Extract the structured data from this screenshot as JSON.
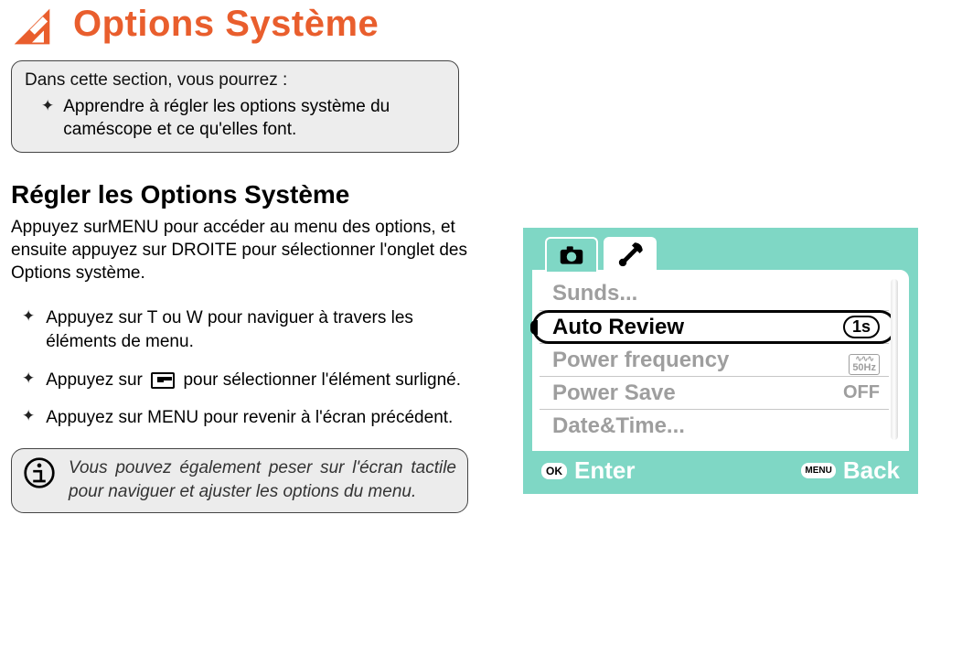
{
  "header": {
    "title": "Options Système"
  },
  "intro": {
    "lead": "Dans cette section, vous pourrez :",
    "item": "Apprendre à régler les options système du caméscope et ce qu'elles font."
  },
  "section": {
    "title": "Régler les Options Système",
    "paragraph": "Appuyez surMENU pour accéder au menu des options, et ensuite appuyez sur DROITE pour sélectionner l'onglet des Options système.",
    "bullets": {
      "b1": "Appuyez sur T ou W pour naviguer à travers les éléments de menu.",
      "b2a": "Appuyez sur",
      "b2b": "pour sélectionner l'élément surligné.",
      "b3": "Appuyez sur MENU pour revenir à l'écran précédent."
    },
    "tip": "Vous pouvez également peser sur l'écran tactile pour naviguer et ajuster les options du menu."
  },
  "lcd": {
    "menu": {
      "row1": "Sunds...",
      "row2_label": "Auto Review",
      "row2_value": "1s",
      "row3_label": "Power frequency",
      "row3_value": "50Hz",
      "row4_label": "Power Save",
      "row4_value": "OFF",
      "row5": "Date&Time..."
    },
    "footer": {
      "ok_chip": "OK",
      "enter": "Enter",
      "menu_chip": "MENU",
      "back": "Back"
    }
  }
}
